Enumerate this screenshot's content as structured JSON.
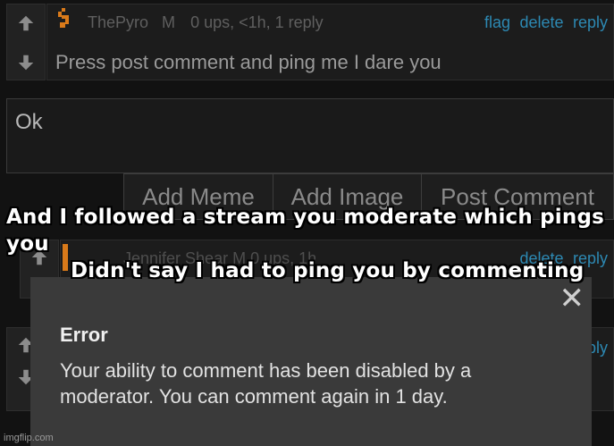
{
  "comment1": {
    "author": "ThePyro",
    "flair": "M",
    "meta": "0 ups, <1h, 1 reply",
    "actions": [
      "flag",
      "delete",
      "reply"
    ],
    "text": "Press post comment and ping me I dare you"
  },
  "reply_box": {
    "text": "Ok"
  },
  "buttons": {
    "add_meme": "Add Meme",
    "add_image": "Add Image",
    "post_comment": "Post Comment"
  },
  "comment2": {
    "meta": "Jennifer Shear M 0 ups, 1h",
    "actions": [
      "delete",
      "reply"
    ]
  },
  "comment3": {
    "action": "ply"
  },
  "caption": {
    "line1": "And I followed a stream you moderate which pings you",
    "line2": "Didn't say I had to ping you by commenting"
  },
  "dialog": {
    "title": "Error",
    "message_line1": "Your ability to comment has been disabled by a",
    "message_line2": "moderator. You can comment again in 1 day.",
    "close": "✕"
  },
  "watermark": "imgflip.com",
  "colors": {
    "link": "#2d89b3",
    "avatar": "#d97a1a",
    "dialog_bg": "#3a3a3a"
  }
}
